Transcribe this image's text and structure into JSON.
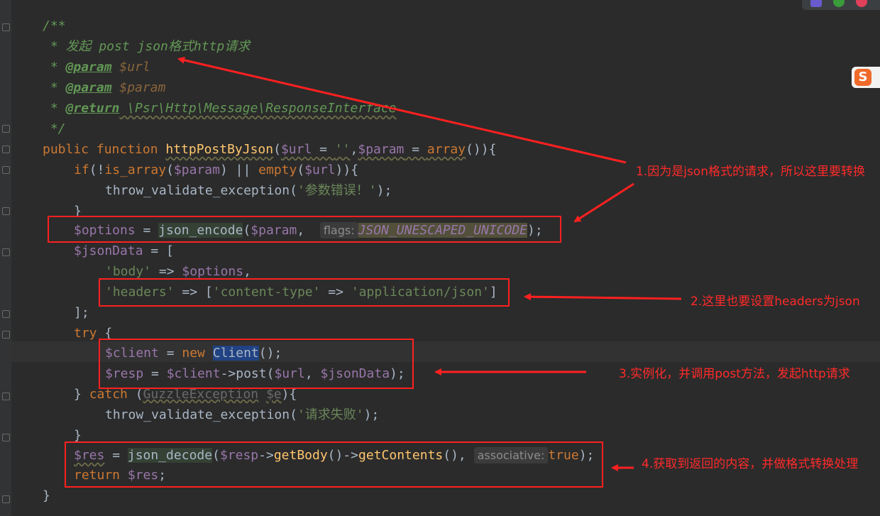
{
  "code": {
    "l1": "/**",
    "l2_pre": " * 发起 post json",
    "l2_cjk": "格式",
    "l2_http": "http",
    "l2_end": "请求",
    "l3_star": " * ",
    "l3_tag": "@param",
    "l3_var": " $url",
    "l4_star": " * ",
    "l4_tag": "@param",
    "l4_var": " $param",
    "l5_star": " * ",
    "l5_tag": "@return",
    "l5_type": " \\Psr\\Http\\Message\\ResponseInterface",
    "l6": " */",
    "l7_kw": "public function ",
    "l7_fn": "httpPostByJson",
    "l7_p1": "(",
    "l7_v1": "$url",
    "l7_p2": " = ",
    "l7_s1": "''",
    "l7_p3": ",",
    "l7_v2": "$param",
    "l7_p4": " = ",
    "l7_kw2": "array",
    "l7_p5": "()){",
    "l8_kw": "if",
    "l8_p1": "(!",
    "l8_fn": "is_array",
    "l8_p2": "(",
    "l8_v": "$param",
    "l8_p3": ") || ",
    "l8_kw2": "empty",
    "l8_p4": "(",
    "l8_v2": "$url",
    "l8_p5": ")){",
    "l9_fn": "throw_validate_exception",
    "l9_p1": "(",
    "l9_s": "'参数错误！'",
    "l9_p2": ");",
    "l10": "}",
    "l11_v": "$options",
    "l11_p1": " = ",
    "l11_fn": "json_encode",
    "l11_p2": "(",
    "l11_v2": "$param",
    "l11_p3": ",  ",
    "l11_hint": "flags:",
    "l11_const": "JSON_UNESCAPED_UNICODE",
    "l11_p4": ");",
    "l12_v": "$jsonData",
    "l12_p": " = [",
    "l13_s": "'body'",
    "l13_p": " => ",
    "l13_v": "$options",
    "l13_p2": ",",
    "l14_s1": "'headers'",
    "l14_p1": " => [",
    "l14_s2": "'content-type'",
    "l14_p2": " => ",
    "l14_s3": "'application/json'",
    "l14_p3": "]",
    "l15": "];",
    "l16_kw": "try",
    "l16_p": " {",
    "l17_v": "$client",
    "l17_p1": " = ",
    "l17_kw": "new",
    "l17_sp": " ",
    "l17_cls": "Client",
    "l17_p2": "();",
    "l18_v": "$resp",
    "l18_p1": " = ",
    "l18_v2": "$client",
    "l18_p2": "->",
    "l18_fn": "post",
    "l18_p3": "(",
    "l18_v3": "$url",
    "l18_p4": ", ",
    "l18_v4": "$jsonData",
    "l18_p5": ");",
    "l19_p1": "} ",
    "l19_kw": "catch",
    "l19_p2": " (",
    "l19_cls": "GuzzleException",
    "l19_sp": " ",
    "l19_v": "$e",
    "l19_p3": "){",
    "l20_fn": "throw_validate_exception",
    "l20_p1": "(",
    "l20_s": "'请求失败'",
    "l20_p2": ");",
    "l21": "}",
    "l22_v": "$res",
    "l22_p1": " = ",
    "l22_fn": "json_decode",
    "l22_p2": "(",
    "l22_v2": "$resp",
    "l22_p3": "->",
    "l22_fn2": "getBody",
    "l22_p4": "()->",
    "l22_fn3": "getContents",
    "l22_p5": "(), ",
    "l22_hint": "associative:",
    "l22_kw": "true",
    "l22_p6": ");",
    "l23_kw": "return",
    "l23_sp": " ",
    "l23_v": "$res",
    "l23_p": ";",
    "l24": "}"
  },
  "annotations": {
    "note1": "1.因为是json格式的请求，所以这里要转换",
    "note2": "2.这里也要设置headers为json",
    "note3": "3.实例化，并调用post方法，发起http请求",
    "note4": "4.获取到返回的内容，并做格式转换处理"
  },
  "ime_logo": "S",
  "colors": {
    "background": "#2b2b2b",
    "keyword": "#cc7832",
    "function": "#ffc66d",
    "variable": "#9876aa",
    "string": "#6a8759",
    "comment": "#629755",
    "annotation": "#ff2020"
  }
}
